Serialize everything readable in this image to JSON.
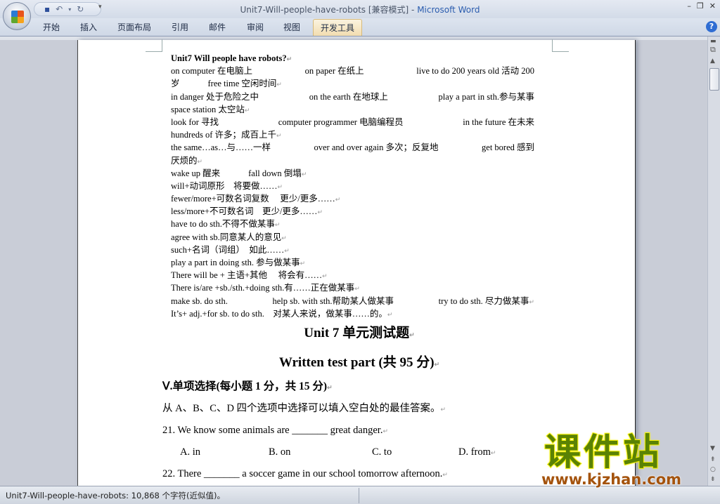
{
  "window": {
    "title_doc": "Unit7-Will-people-have-robots [兼容模式]",
    "title_sep": " - ",
    "title_app": "Microsoft Word",
    "minimize": "–",
    "restore": "❐",
    "close": "✕"
  },
  "qat": {
    "save_icon": "💾",
    "undo_icon": "↶",
    "undo_more": "▾",
    "redo_icon": "↻",
    "customize": "▾"
  },
  "ribbon": {
    "tabs": [
      "开始",
      "插入",
      "页面布局",
      "引用",
      "邮件",
      "审阅",
      "视图",
      "开发工具"
    ],
    "active_tab": "开发工具",
    "help": "?"
  },
  "doc": {
    "lines": [
      {
        "segments": [
          "Unit7 Will people have robots?"
        ]
      },
      {
        "segments": [
          "on computer 在电脑上",
          "on paper 在纸上",
          "live to do 200 years old 活动 200"
        ]
      },
      {
        "segments": [
          "岁",
          "free time 空闲时间"
        ]
      },
      {
        "segments": [
          "in danger 处于危险之中",
          "on the earth 在地球上",
          "play a part in sth.参与某事"
        ]
      },
      {
        "segments": [
          "space station 太空站"
        ]
      },
      {
        "segments": [
          "look for 寻找",
          "computer programmer 电脑编程员",
          "in the future 在未来"
        ]
      },
      {
        "segments": [
          "hundreds of 许多；成百上千"
        ]
      },
      {
        "segments": [
          "the same…as…与……一样",
          "over and over again 多次；反复地",
          "get bored 感到"
        ]
      },
      {
        "segments": [
          "厌烦的"
        ]
      },
      {
        "segments": [
          "wake up 醒来",
          "fall down 倒塌"
        ]
      },
      {
        "segments": [
          "will+动词原形　将要做……"
        ]
      },
      {
        "segments": [
          "fewer/more+可数名词复数　 更少/更多……"
        ]
      },
      {
        "segments": [
          "less/more+不可数名词　更少/更多……"
        ]
      },
      {
        "segments": [
          "have to do sth.不得不做某事"
        ]
      },
      {
        "segments": [
          "agree with sb.同意某人的意见"
        ]
      },
      {
        "segments": [
          "such+名词（词组）　如此……"
        ]
      },
      {
        "segments": [
          "play a part in doing sth.  参与做某事"
        ]
      },
      {
        "segments": [
          "There will be +  主语+其他　 将会有……"
        ]
      },
      {
        "segments": [
          "There is/are +sb./sth.+doing sth.有……正在做某事"
        ]
      },
      {
        "segments": [
          "make sb. do sth.",
          "help sb. with sth.帮助某人做某事",
          "try to do sth.  尽力做某事"
        ]
      },
      {
        "segments": [
          "It’s+ adj.+for sb. to do sth.　对某人来说，做某事……的。"
        ]
      }
    ],
    "test_title": "Unit  7  单元测试题",
    "test_subtitle": "Written  test part (共 95 分)",
    "section": "Ⅴ.单项选择(每小题 1 分，共 15 分)",
    "instruction": "从 A、B、C、D 四个选项中选择可以填入空白处的最佳答案。",
    "q21": "21. We know some animals are _______ great danger.",
    "q21_options": [
      "A. in",
      "B. on",
      "C. to",
      "D. from"
    ],
    "q22": "22. There _______ a soccer game in our school tomorrow afternoon."
  },
  "status": {
    "text": "Unit7-Will-people-have-robots: 10,868 个字符(近似值)。"
  },
  "watermark": {
    "cn": "课件站",
    "url": "www.kjzhan.com"
  },
  "colors": {
    "accent": "#2a5cae",
    "watermark_green": "#5a8204",
    "watermark_brown": "#a4530d"
  }
}
